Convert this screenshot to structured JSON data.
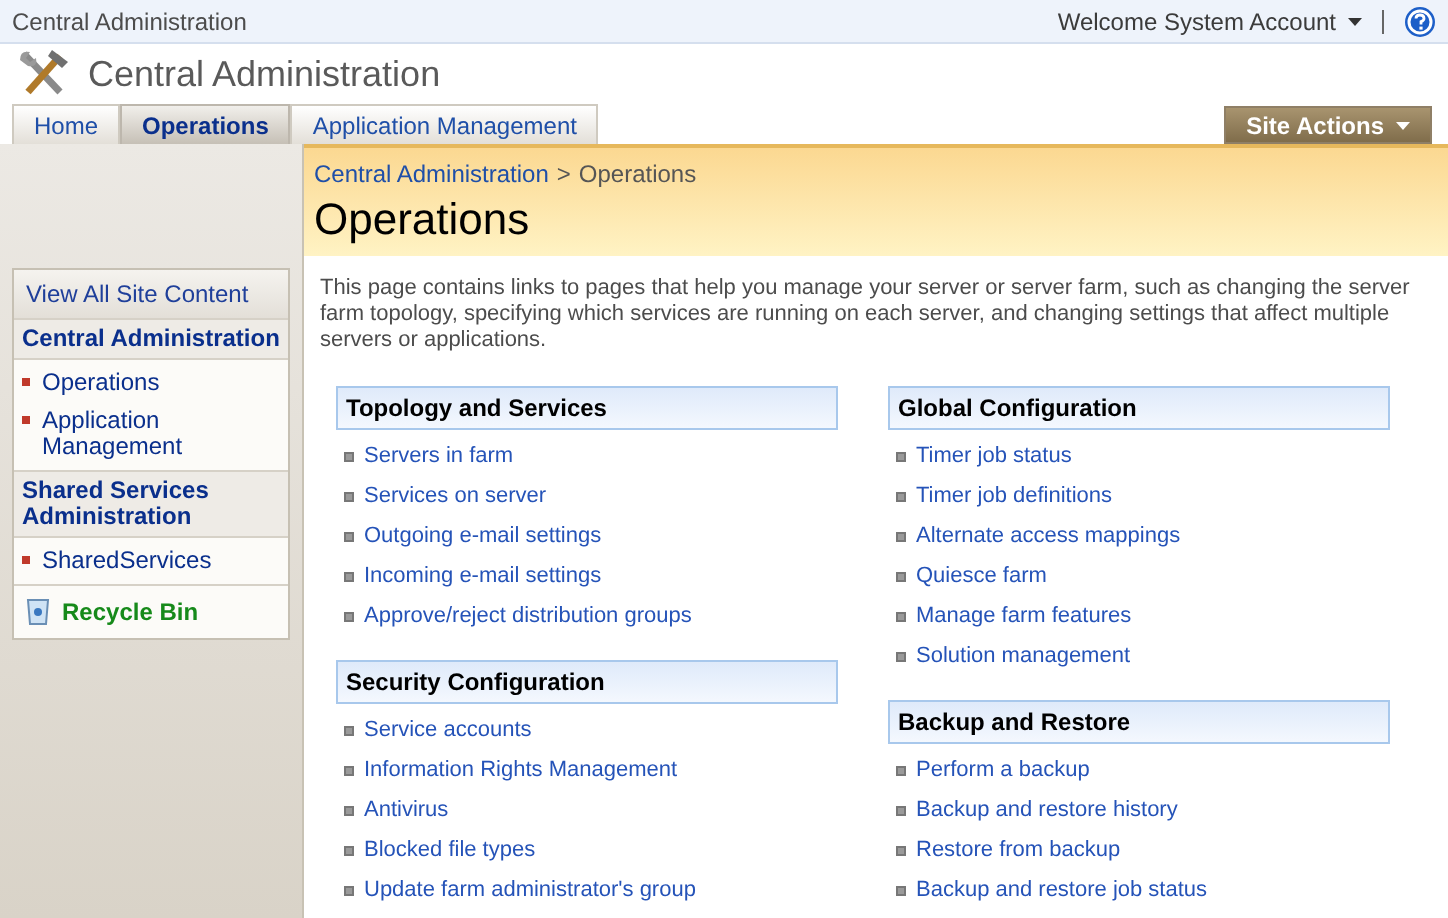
{
  "top_bar": {
    "title": "Central Administration",
    "user_menu": "Welcome System Account"
  },
  "header": {
    "site_title": "Central Administration"
  },
  "tabs": [
    {
      "label": "Home",
      "selected": false
    },
    {
      "label": "Operations",
      "selected": true
    },
    {
      "label": "Application Management",
      "selected": false
    }
  ],
  "site_actions": "Site Actions",
  "sidebar": {
    "view_all": "View All Site Content",
    "sections": [
      {
        "heading": "Central Administration",
        "items": [
          "Operations",
          "Application Management"
        ]
      },
      {
        "heading": "Shared Services Administration",
        "items": [
          "SharedServices"
        ]
      }
    ],
    "recycle_bin": "Recycle Bin"
  },
  "breadcrumb": {
    "link": "Central Administration",
    "separator": ">",
    "current": "Operations"
  },
  "page_title": "Operations",
  "description": "This page contains links to pages that help you manage your server or server farm, such as changing the server farm topology, specifying which services are running on each server, and changing settings that affect multiple servers or applications.",
  "columns": [
    [
      {
        "heading": "Topology and Services",
        "links": [
          "Servers in farm",
          "Services on server",
          "Outgoing e-mail settings",
          "Incoming e-mail settings",
          "Approve/reject distribution groups"
        ]
      },
      {
        "heading": "Security Configuration",
        "links": [
          "Service accounts",
          "Information Rights Management",
          "Antivirus",
          "Blocked file types",
          "Update farm administrator's group"
        ]
      }
    ],
    [
      {
        "heading": "Global Configuration",
        "links": [
          "Timer job status",
          "Timer job definitions",
          "Alternate access mappings",
          "Quiesce farm",
          "Manage farm features",
          "Solution management"
        ]
      },
      {
        "heading": "Backup and Restore",
        "links": [
          "Perform a backup",
          "Backup and restore history",
          "Restore from backup",
          "Backup and restore job status"
        ]
      }
    ]
  ]
}
